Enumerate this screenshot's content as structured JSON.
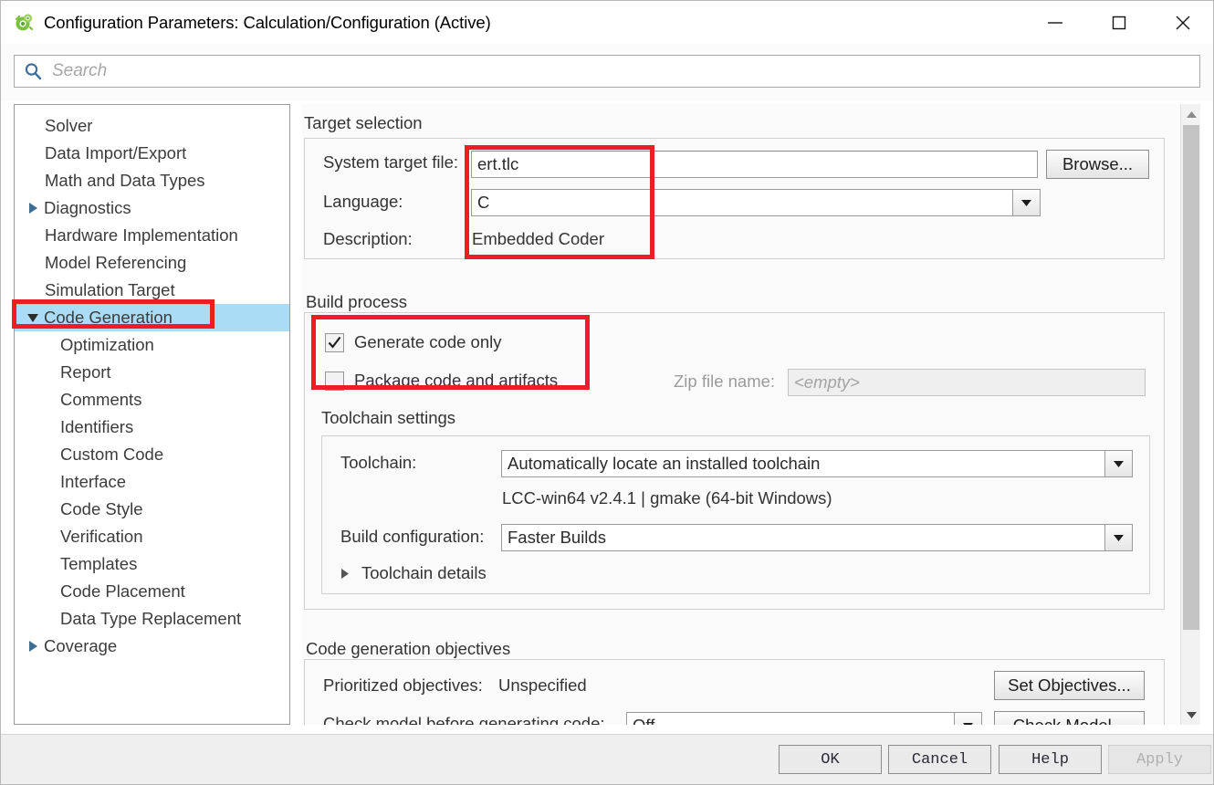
{
  "window": {
    "title": "Configuration Parameters: Calculation/Configuration (Active)",
    "icon": "simulink-icon",
    "minimize": "minimize-icon",
    "maximize": "maximize-icon",
    "close": "close-icon"
  },
  "search": {
    "placeholder": "Search",
    "icon": "search-icon"
  },
  "tree": {
    "items": [
      {
        "label": "Solver",
        "level": 0,
        "arrow": "none",
        "selected": false
      },
      {
        "label": "Data Import/Export",
        "level": 0,
        "arrow": "none",
        "selected": false
      },
      {
        "label": "Math and Data Types",
        "level": 0,
        "arrow": "none",
        "selected": false
      },
      {
        "label": "Diagnostics",
        "level": 0,
        "arrow": "collapsed",
        "selected": false
      },
      {
        "label": "Hardware Implementation",
        "level": 0,
        "arrow": "none",
        "selected": false
      },
      {
        "label": "Model Referencing",
        "level": 0,
        "arrow": "none",
        "selected": false
      },
      {
        "label": "Simulation Target",
        "level": 0,
        "arrow": "none",
        "selected": false
      },
      {
        "label": "Code Generation",
        "level": 0,
        "arrow": "expanded",
        "selected": true
      },
      {
        "label": "Optimization",
        "level": 1,
        "arrow": "none",
        "selected": false
      },
      {
        "label": "Report",
        "level": 1,
        "arrow": "none",
        "selected": false
      },
      {
        "label": "Comments",
        "level": 1,
        "arrow": "none",
        "selected": false
      },
      {
        "label": "Identifiers",
        "level": 1,
        "arrow": "none",
        "selected": false
      },
      {
        "label": "Custom Code",
        "level": 1,
        "arrow": "none",
        "selected": false
      },
      {
        "label": "Interface",
        "level": 1,
        "arrow": "none",
        "selected": false
      },
      {
        "label": "Code Style",
        "level": 1,
        "arrow": "none",
        "selected": false
      },
      {
        "label": "Verification",
        "level": 1,
        "arrow": "none",
        "selected": false
      },
      {
        "label": "Templates",
        "level": 1,
        "arrow": "none",
        "selected": false
      },
      {
        "label": "Code Placement",
        "level": 1,
        "arrow": "none",
        "selected": false
      },
      {
        "label": "Data Type Replacement",
        "level": 1,
        "arrow": "none",
        "selected": false
      },
      {
        "label": "Coverage",
        "level": 0,
        "arrow": "collapsed",
        "selected": false
      }
    ]
  },
  "target_selection": {
    "section_label": "Target selection",
    "system_target_file": {
      "label": "System target file:",
      "value": "ert.tlc"
    },
    "browse_button": "Browse...",
    "language": {
      "label": "Language:",
      "value": "C"
    },
    "description": {
      "label": "Description:",
      "value": "Embedded Coder"
    }
  },
  "build_process": {
    "section_label": "Build process",
    "generate_code_only": {
      "label": "Generate code only",
      "checked": true
    },
    "package_code": {
      "label": "Package code and artifacts",
      "checked": false
    },
    "zip_file_name": {
      "label": "Zip file name:",
      "placeholder": "<empty>",
      "enabled": false
    },
    "toolchain_settings": {
      "section_label": "Toolchain settings",
      "toolchain": {
        "label": "Toolchain:",
        "value": "Automatically locate an installed toolchain"
      },
      "toolchain_info": "LCC-win64 v2.4.1 | gmake (64-bit Windows)",
      "build_configuration": {
        "label": "Build configuration:",
        "value": "Faster Builds"
      },
      "toolchain_details": {
        "label": "Toolchain details",
        "expanded": false
      }
    }
  },
  "code_generation_objectives": {
    "section_label": "Code generation objectives",
    "prioritized_objectives": {
      "label": "Prioritized objectives:",
      "value": "Unspecified"
    },
    "set_objectives_button": "Set Objectives...",
    "check_model": {
      "label": "Check model before generating code:",
      "value": "Off"
    },
    "check_model_button": "Check Model..."
  },
  "footer": {
    "ok": "OK",
    "cancel": "Cancel",
    "help": "Help",
    "apply": "Apply"
  },
  "colors": {
    "annotation": "#ee1c25",
    "selection": "#aadcf5",
    "search_icon": "#3b6e9b"
  }
}
